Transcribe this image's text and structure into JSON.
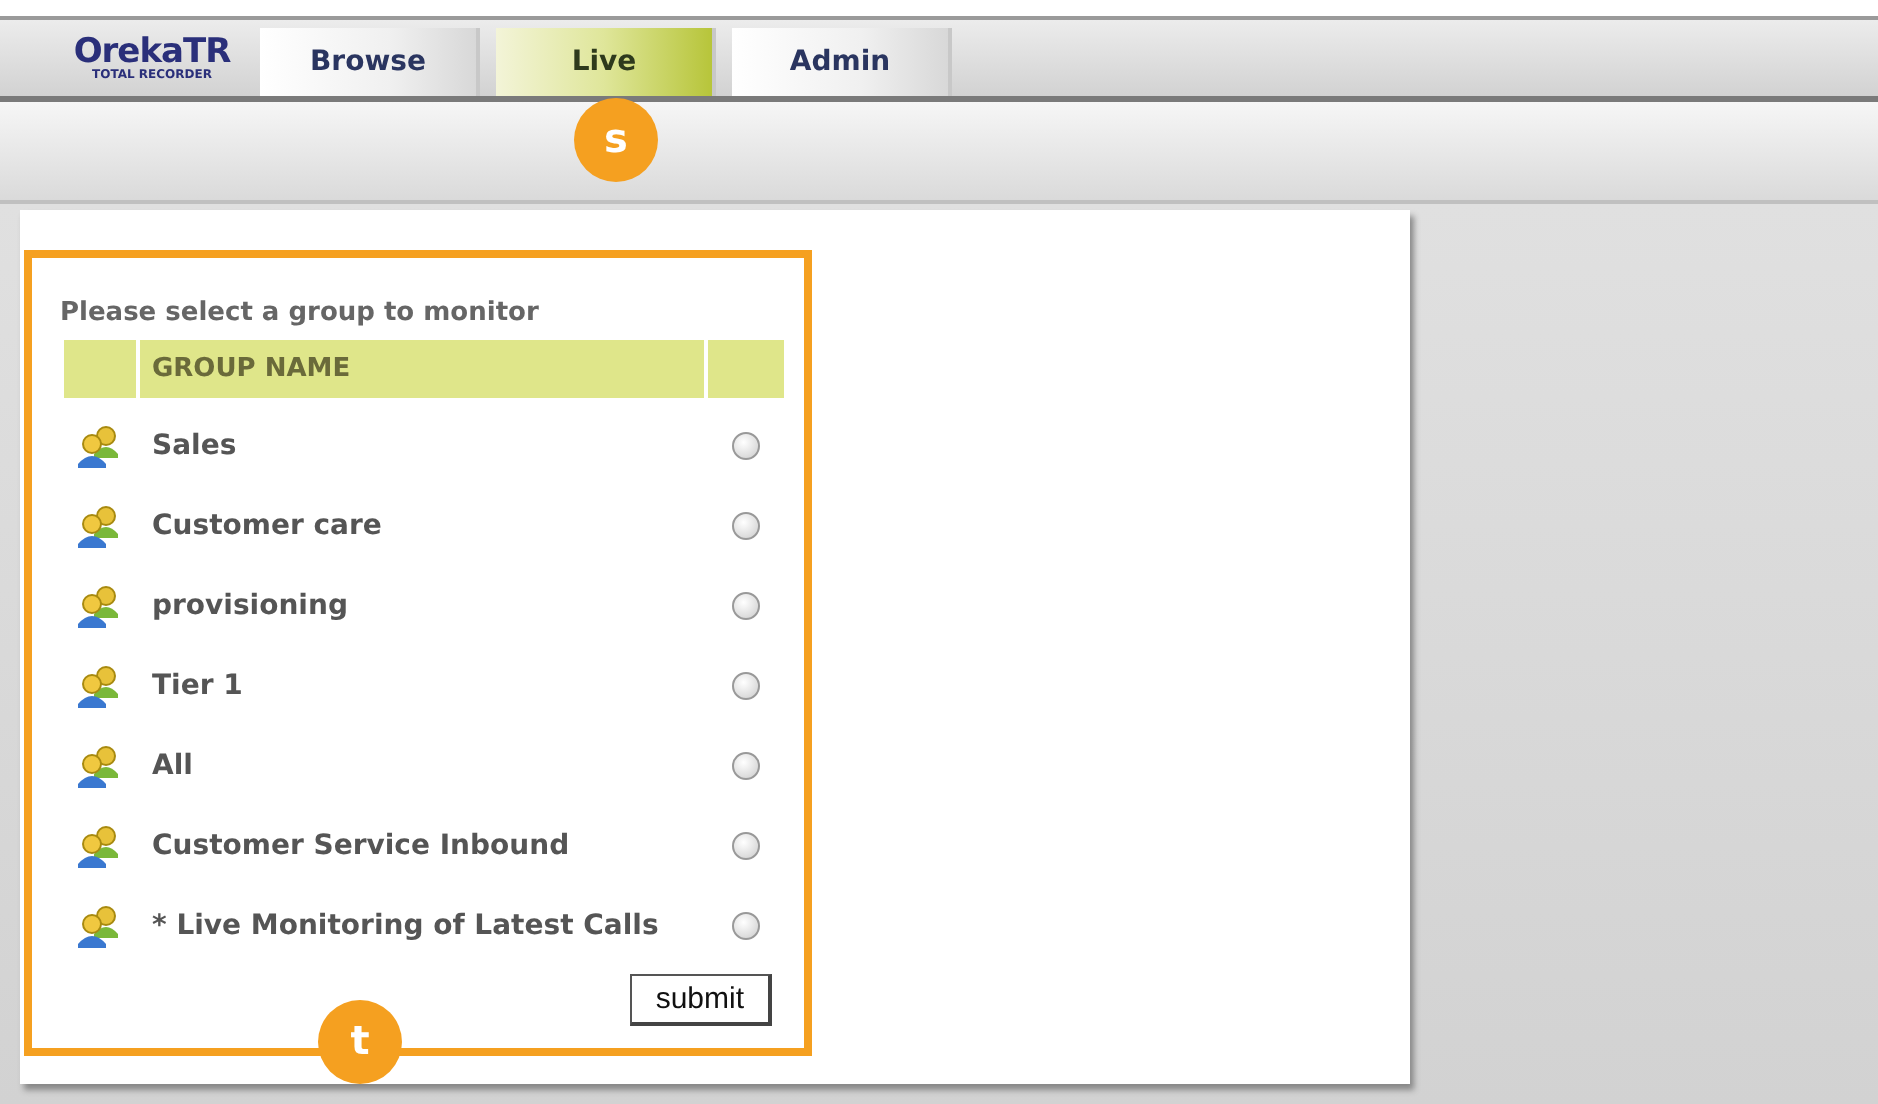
{
  "logo": {
    "name": "OrekaTR",
    "tagline": "TOTAL RECORDER"
  },
  "tabs": [
    {
      "label": "Browse",
      "selected": false
    },
    {
      "label": "Live",
      "selected": true
    },
    {
      "label": "Admin",
      "selected": false
    }
  ],
  "annotations": {
    "tabs_marker": "s",
    "panel_marker": "t"
  },
  "panel": {
    "prompt": "Please select a group to monitor",
    "column_header": "GROUP NAME",
    "groups": [
      {
        "name": "Sales",
        "selected": false
      },
      {
        "name": "Customer care",
        "selected": false
      },
      {
        "name": "provisioning",
        "selected": false
      },
      {
        "name": "Tier 1",
        "selected": false
      },
      {
        "name": "All",
        "selected": false
      },
      {
        "name": "Customer Service Inbound",
        "selected": false
      },
      {
        "name": "* Live Monitoring of Latest Calls",
        "selected": false
      }
    ],
    "submit": "submit"
  }
}
